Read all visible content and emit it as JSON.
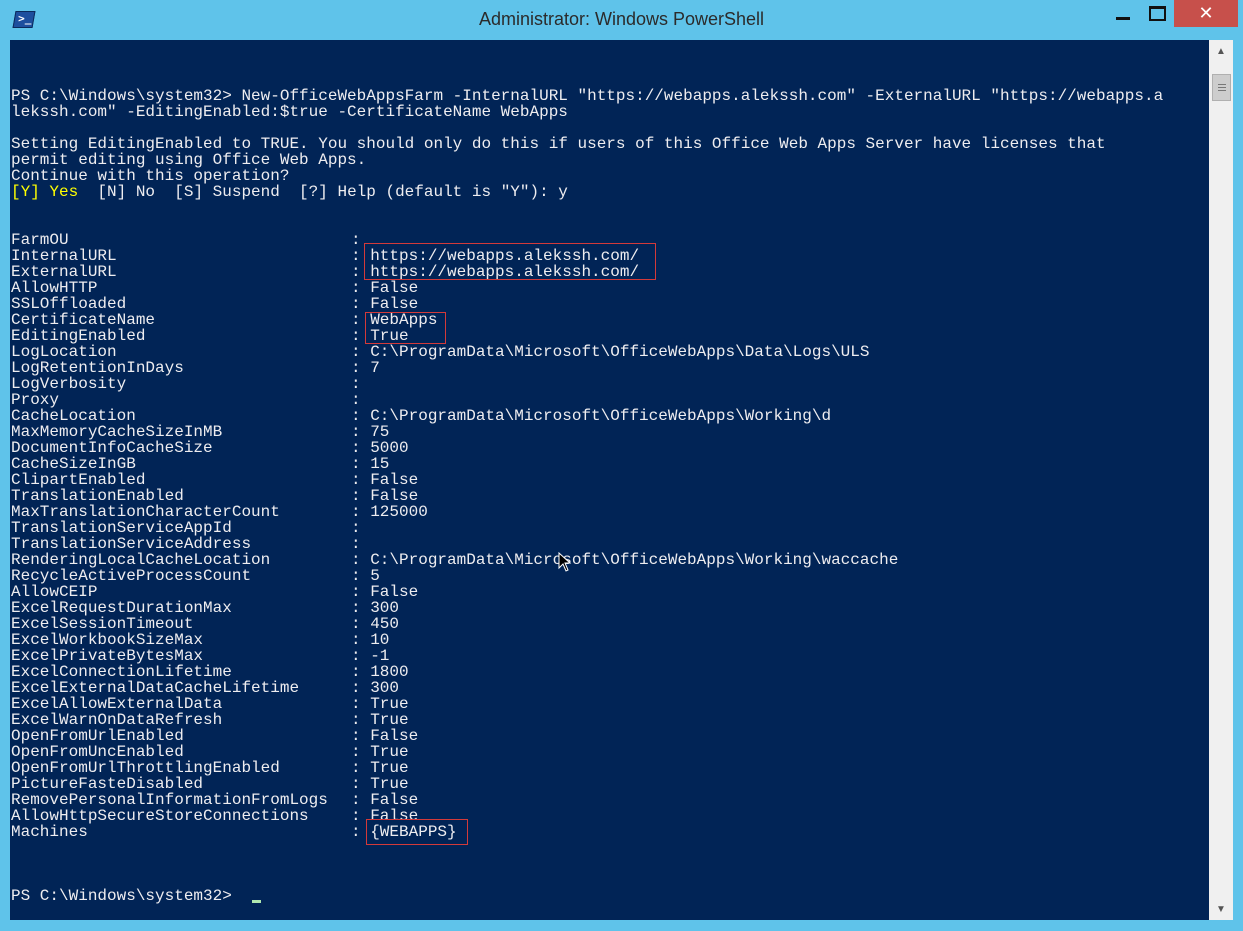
{
  "window": {
    "title": "Administrator: Windows PowerShell",
    "icon": "powershell-icon",
    "controls": [
      "minimize-icon",
      "maximize-icon",
      "close-icon"
    ],
    "close_glyph": "✕"
  },
  "console": {
    "command_line_1": "PS C:\\Windows\\system32> New-OfficeWebAppsFarm -InternalURL \"https://webapps.alekssh.com\" -ExternalURL \"https://webapps.a",
    "command_line_2": "lekssh.com\" -EditingEnabled:$true -CertificateName WebApps",
    "warning_1": "Setting EditingEnabled to TRUE. You should only do this if users of this Office Web Apps Server have licenses that",
    "warning_2": "permit editing using Office Web Apps.",
    "warning_3": "Continue with this operation?",
    "prompt_yes": "[Y] Yes",
    "prompt_rest": "  [N] No  [S] Suspend  [?] Help (default is \"Y\"): y",
    "properties": [
      {
        "name": "FarmOU",
        "value": ""
      },
      {
        "name": "InternalURL",
        "value": "https://webapps.alekssh.com/"
      },
      {
        "name": "ExternalURL",
        "value": "https://webapps.alekssh.com/"
      },
      {
        "name": "AllowHTTP",
        "value": "False"
      },
      {
        "name": "SSLOffloaded",
        "value": "False"
      },
      {
        "name": "CertificateName",
        "value": "WebApps"
      },
      {
        "name": "EditingEnabled",
        "value": "True"
      },
      {
        "name": "LogLocation",
        "value": "C:\\ProgramData\\Microsoft\\OfficeWebApps\\Data\\Logs\\ULS"
      },
      {
        "name": "LogRetentionInDays",
        "value": "7"
      },
      {
        "name": "LogVerbosity",
        "value": ""
      },
      {
        "name": "Proxy",
        "value": ""
      },
      {
        "name": "CacheLocation",
        "value": "C:\\ProgramData\\Microsoft\\OfficeWebApps\\Working\\d"
      },
      {
        "name": "MaxMemoryCacheSizeInMB",
        "value": "75"
      },
      {
        "name": "DocumentInfoCacheSize",
        "value": "5000"
      },
      {
        "name": "CacheSizeInGB",
        "value": "15"
      },
      {
        "name": "ClipartEnabled",
        "value": "False"
      },
      {
        "name": "TranslationEnabled",
        "value": "False"
      },
      {
        "name": "MaxTranslationCharacterCount",
        "value": "125000"
      },
      {
        "name": "TranslationServiceAppId",
        "value": ""
      },
      {
        "name": "TranslationServiceAddress",
        "value": ""
      },
      {
        "name": "RenderingLocalCacheLocation",
        "value": "C:\\ProgramData\\Microsoft\\OfficeWebApps\\Working\\waccache"
      },
      {
        "name": "RecycleActiveProcessCount",
        "value": "5"
      },
      {
        "name": "AllowCEIP",
        "value": "False"
      },
      {
        "name": "ExcelRequestDurationMax",
        "value": "300"
      },
      {
        "name": "ExcelSessionTimeout",
        "value": "450"
      },
      {
        "name": "ExcelWorkbookSizeMax",
        "value": "10"
      },
      {
        "name": "ExcelPrivateBytesMax",
        "value": "-1"
      },
      {
        "name": "ExcelConnectionLifetime",
        "value": "1800"
      },
      {
        "name": "ExcelExternalDataCacheLifetime",
        "value": "300"
      },
      {
        "name": "ExcelAllowExternalData",
        "value": "True"
      },
      {
        "name": "ExcelWarnOnDataRefresh",
        "value": "True"
      },
      {
        "name": "OpenFromUrlEnabled",
        "value": "False"
      },
      {
        "name": "OpenFromUncEnabled",
        "value": "True"
      },
      {
        "name": "OpenFromUrlThrottlingEnabled",
        "value": "True"
      },
      {
        "name": "PictureFasteDisabled",
        "value": "True"
      },
      {
        "name": "RemovePersonalInformationFromLogs",
        "value": "False"
      },
      {
        "name": "AllowHttpSecureStoreConnections",
        "value": "False"
      },
      {
        "name": "Machines",
        "value": "{WEBAPPS}"
      }
    ],
    "final_prompt": "PS C:\\Windows\\system32> "
  },
  "colors": {
    "console_bg": "#012456",
    "console_text": "#eeedf0",
    "prompt_highlight": "#ffff00",
    "annotation_border": "#d33a3a",
    "frame": "#5fc3ea",
    "close_button": "#c7504b"
  }
}
